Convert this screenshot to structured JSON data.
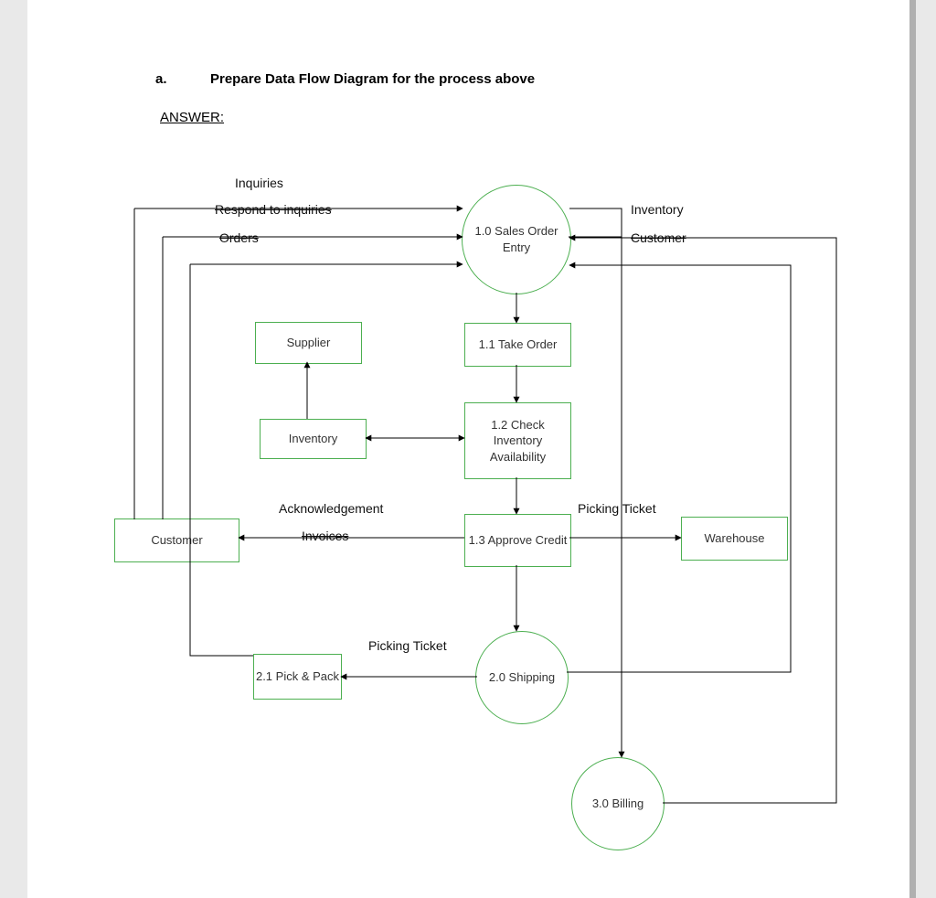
{
  "heading": {
    "letter": "a.",
    "text": "Prepare Data Flow Diagram for the process above"
  },
  "answer_label": "ANSWER:",
  "flow_labels": {
    "inquiries": "Inquiries",
    "respond": "Respond to inquiries",
    "orders": "Orders",
    "inventory": "Inventory",
    "customer_top": "Customer",
    "ack": "Acknowledgement",
    "invoices": "Invoices",
    "picking_ticket_right": "Picking Ticket",
    "picking_ticket_left": "Picking Ticket"
  },
  "nodes": {
    "sales_order_entry": "1.0 Sales Order Entry",
    "take_order": "1.1 Take Order",
    "check_inventory": "1.2 Check Inventory Availability",
    "approve_credit": "1.3 Approve Credit",
    "shipping": "2.0 Shipping",
    "pick_pack": "2.1 Pick & Pack",
    "billing": "3.0 Billing",
    "supplier": "Supplier",
    "inventory_store": "Inventory",
    "customer": "Customer",
    "warehouse": "Warehouse"
  }
}
